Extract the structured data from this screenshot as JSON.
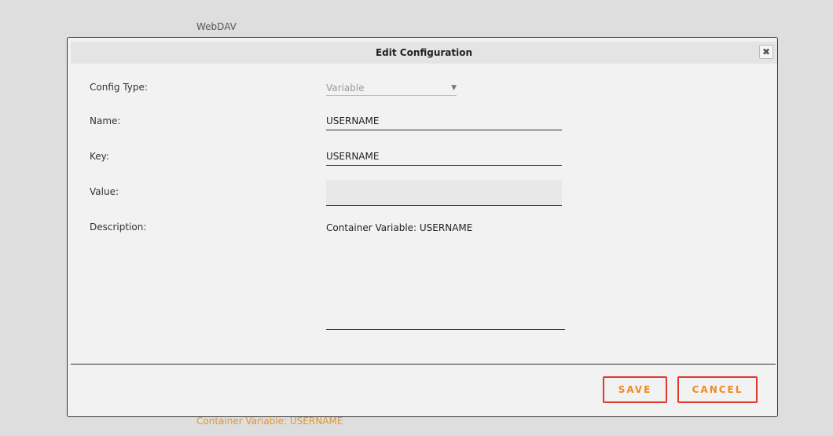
{
  "background": {
    "top_label": "WebDAV",
    "bottom_label": "Container Variable: USERNAME"
  },
  "dialog": {
    "title": "Edit Configuration",
    "close_icon": "close-icon",
    "fields": {
      "config_type": {
        "label": "Config Type:",
        "value": "Variable"
      },
      "name": {
        "label": "Name:",
        "value": "USERNAME"
      },
      "key": {
        "label": "Key:",
        "value": "USERNAME"
      },
      "value": {
        "label": "Value:",
        "value": ""
      },
      "description": {
        "label": "Description:",
        "value": "Container Variable: USERNAME"
      }
    },
    "buttons": {
      "save": "SAVE",
      "cancel": "CANCEL"
    },
    "colors": {
      "button_border": "#e0392f",
      "button_text": "#f08a24"
    }
  }
}
